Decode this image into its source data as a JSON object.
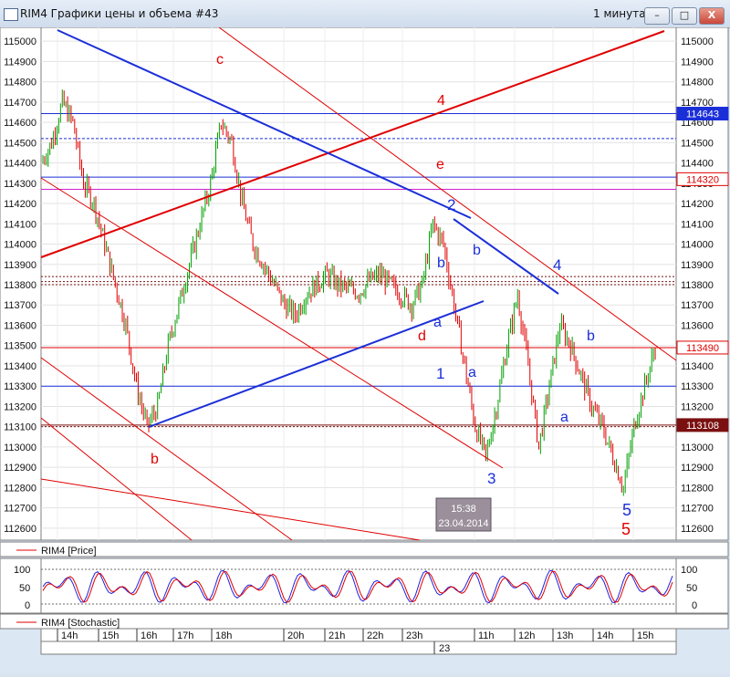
{
  "window": {
    "title": "RIM4 Графики цены и объема #43",
    "interval": "1 минута",
    "buttons": [
      "–",
      "□",
      "X"
    ]
  },
  "price_panel": {
    "legend": "RIM4 [Price]",
    "y_ticks": [
      115000,
      114900,
      114800,
      114700,
      114600,
      114500,
      114400,
      114300,
      114200,
      114100,
      114000,
      113900,
      113800,
      113700,
      113600,
      113500,
      113400,
      113300,
      113200,
      113100,
      113000,
      112900,
      112800,
      112700,
      112600
    ],
    "right_labels": [
      {
        "text": "114643",
        "value": 114643,
        "bg": "#1b2fd8",
        "fg": "#ffffff"
      },
      {
        "text": "114320",
        "value": 114320,
        "bg": "#ffffff",
        "fg": "#e00000"
      },
      {
        "text": "113490",
        "value": 113490,
        "bg": "#ffffff",
        "fg": "#e00000"
      },
      {
        "text": "113108",
        "value": 113108,
        "bg": "#7a1010",
        "fg": "#ffffff"
      }
    ],
    "annotations_red": [
      "c",
      "4",
      "e",
      "d",
      "b",
      "5"
    ],
    "annotations_blue": [
      "2",
      "b",
      "b",
      "a",
      "1",
      "a",
      "3",
      "4",
      "b",
      "a",
      "5"
    ],
    "tooltip": {
      "time": "15:38",
      "date": "23.04.2014"
    }
  },
  "stochastic_panel": {
    "legend": "RIM4 [Stochastic]",
    "y_ticks": [
      "100",
      "50",
      "0"
    ],
    "left_ticks": [
      "100",
      "50",
      "0"
    ]
  },
  "time_axis": {
    "hours": [
      "14h",
      "15h",
      "16h",
      "17h",
      "18h",
      "20h",
      "21h",
      "22h",
      "23h",
      "11h",
      "12h",
      "13h",
      "14h",
      "15h"
    ],
    "date": "23"
  },
  "colors": {
    "up": "#00a000",
    "down": "#e00000",
    "trend_blue": "#1b2fd8",
    "trend_red": "#e00000",
    "stoch_k": "#2020e0",
    "stoch_d": "#e00000"
  },
  "chart_data": {
    "type": "candlestick",
    "ylim": [
      112550,
      115050
    ],
    "series": [
      {
        "name": "RIM4 [Price]",
        "values": [
          114400,
          114500,
          114700,
          114600,
          114300,
          114200,
          114000,
          113800,
          113600,
          113300,
          113100,
          113200,
          113500,
          113700,
          113900,
          114100,
          114300,
          114600,
          114500,
          114200,
          114000,
          113900,
          113800,
          113700,
          113650,
          113750,
          113800,
          113850,
          113800,
          113780,
          113760,
          113820,
          113850,
          113800,
          113750,
          113700,
          113800,
          114100,
          114000,
          113700,
          113400,
          113100,
          112950,
          113200,
          113500,
          113750,
          113400,
          113000,
          113300,
          113600,
          113500,
          113350,
          113200,
          113100,
          112950,
          112800,
          113100,
          113300,
          113490
        ]
      }
    ]
  }
}
